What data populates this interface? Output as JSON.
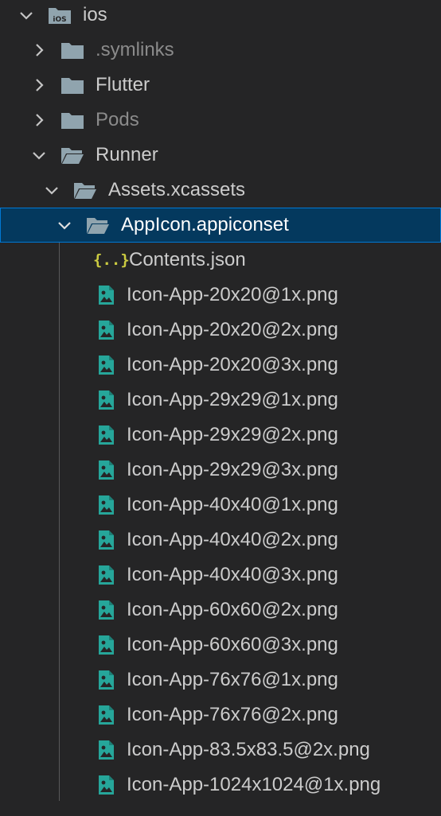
{
  "explorer": {
    "root": {
      "label": "ios",
      "icon": "ios-folder-icon",
      "expanded": true
    },
    "folders": [
      {
        "label": ".symlinks",
        "icon": "folder-icon",
        "expanded": false,
        "dimmed": true
      },
      {
        "label": "Flutter",
        "icon": "folder-icon",
        "expanded": false,
        "dimmed": false
      },
      {
        "label": "Pods",
        "icon": "folder-icon",
        "expanded": false,
        "dimmed": true
      },
      {
        "label": "Runner",
        "icon": "folder-open-icon",
        "expanded": true,
        "dimmed": false
      },
      {
        "label": "Assets.xcassets",
        "icon": "folder-open-icon",
        "expanded": true,
        "dimmed": false
      },
      {
        "label": "AppIcon.appiconset",
        "icon": "folder-open-icon",
        "expanded": true,
        "selected": true
      }
    ],
    "files": [
      {
        "label": "Contents.json",
        "icon": "json-icon"
      },
      {
        "label": "Icon-App-20x20@1x.png",
        "icon": "image-icon"
      },
      {
        "label": "Icon-App-20x20@2x.png",
        "icon": "image-icon"
      },
      {
        "label": "Icon-App-20x20@3x.png",
        "icon": "image-icon"
      },
      {
        "label": "Icon-App-29x29@1x.png",
        "icon": "image-icon"
      },
      {
        "label": "Icon-App-29x29@2x.png",
        "icon": "image-icon"
      },
      {
        "label": "Icon-App-29x29@3x.png",
        "icon": "image-icon"
      },
      {
        "label": "Icon-App-40x40@1x.png",
        "icon": "image-icon"
      },
      {
        "label": "Icon-App-40x40@2x.png",
        "icon": "image-icon"
      },
      {
        "label": "Icon-App-40x40@3x.png",
        "icon": "image-icon"
      },
      {
        "label": "Icon-App-60x60@2x.png",
        "icon": "image-icon"
      },
      {
        "label": "Icon-App-60x60@3x.png",
        "icon": "image-icon"
      },
      {
        "label": "Icon-App-76x76@1x.png",
        "icon": "image-icon"
      },
      {
        "label": "Icon-App-76x76@2x.png",
        "icon": "image-icon"
      },
      {
        "label": "Icon-App-83.5x83.5@2x.png",
        "icon": "image-icon"
      },
      {
        "label": "Icon-App-1024x1024@1x.png",
        "icon": "image-icon"
      }
    ],
    "json_glyph": "{..}",
    "colors": {
      "background": "#252526",
      "selection": "#04395e",
      "selection_border": "#0078d4",
      "folder": "#90a4ae",
      "image_icon": "#26a69a",
      "json_icon": "#cbcb41"
    }
  }
}
